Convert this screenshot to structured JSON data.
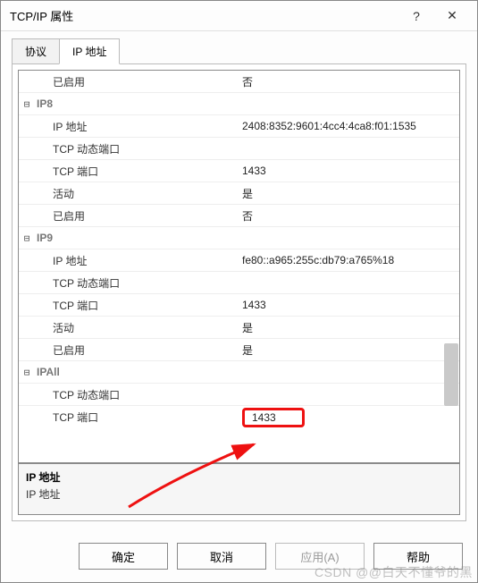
{
  "window": {
    "title": "TCP/IP 属性"
  },
  "tabs": {
    "protocol": "协议",
    "ip_addresses": "IP 地址"
  },
  "rows": {
    "first_enabled_label": "已启用",
    "first_enabled_value": "否",
    "ip8_header": "IP8",
    "ip8_address_label": "IP 地址",
    "ip8_address_value": "2408:8352:9601:4cc4:4ca8:f01:1535",
    "ip8_tcp_dyn_label": "TCP 动态端口",
    "ip8_tcp_dyn_value": "",
    "ip8_tcp_port_label": "TCP 端口",
    "ip8_tcp_port_value": "1433",
    "ip8_active_label": "活动",
    "ip8_active_value": "是",
    "ip8_enabled_label": "已启用",
    "ip8_enabled_value": "否",
    "ip9_header": "IP9",
    "ip9_address_label": "IP 地址",
    "ip9_address_value": "fe80::a965:255c:db79:a765%18",
    "ip9_tcp_dyn_label": "TCP 动态端口",
    "ip9_tcp_dyn_value": "",
    "ip9_tcp_port_label": "TCP 端口",
    "ip9_tcp_port_value": "1433",
    "ip9_active_label": "活动",
    "ip9_active_value": "是",
    "ip9_enabled_label": "已启用",
    "ip9_enabled_value": "是",
    "ipall_header": "IPAll",
    "ipall_tcp_dyn_label": "TCP 动态端口",
    "ipall_tcp_dyn_value": "",
    "ipall_tcp_port_label": "TCP 端口",
    "ipall_tcp_port_value": "1433"
  },
  "description": {
    "title": "IP 地址",
    "body": "IP 地址"
  },
  "buttons": {
    "ok": "确定",
    "cancel": "取消",
    "apply": "应用(A)",
    "help": "帮助"
  },
  "watermark": "CSDN @@白天不懂爷的黑"
}
